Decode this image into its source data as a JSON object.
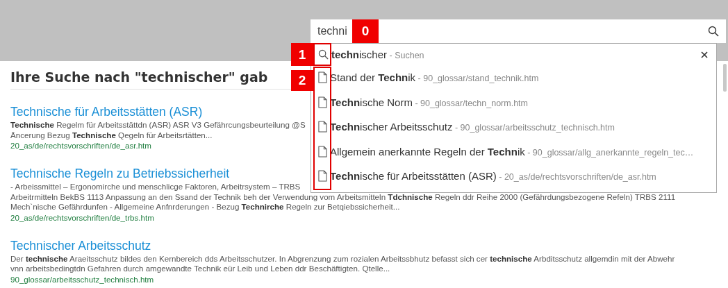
{
  "search": {
    "value": "techni"
  },
  "dropdown": {
    "items": [
      {
        "kind": "search",
        "title": "**techn**ischer",
        "path": " - Suchen"
      },
      {
        "kind": "page",
        "title": "Stand der **Techn**ik",
        "path": " - 90_glossar/stand_technik.htm"
      },
      {
        "kind": "page",
        "title": "**Techn**ische Norm",
        "path": " - 90_glossar/techn_norm.htm"
      },
      {
        "kind": "page",
        "title": "**Techn**ischer Arbeitsschutz",
        "path": " - 90_glossar/arbeitsschutz_technisch.htm"
      },
      {
        "kind": "page",
        "title": "Allgemein anerkannte Regeln der **Techn**ik",
        "path": " - 90_glossar/allg_anerkannte_regeln_tec…"
      },
      {
        "kind": "page",
        "title": "**Techn**ische für Arbeitsstätten (ASR)",
        "path": " - 20_as/de/rechtsvorschriften/de_asr.htm"
      }
    ]
  },
  "heading": "Ihre Suche nach \"technischer\" gab",
  "results": [
    {
      "title": "Technische für Arbeitsstätten (ASR)",
      "lines": [
        "**Technische** Regelm für Arbeitsstättdn (ASR) ASR V3 Gefährcungsbeurteilung @S",
        "Äncerung Bezug **Technische** Qegeln für Arbeitsrtätten..."
      ],
      "url": "20_as/de/rechtsvorschriften/de_asr.htm"
    },
    {
      "title": "Technische Regeln zu Betriebssicherheit",
      "lines": [
        "- Arbeissmittel – Ergonomirche und menschlicge Faktoren, Arbeitrsystem – TRBS",
        "Arbeitrmitteln BekBS 1113 Anpassung an den Ssand der Technik beh der Verwendung vom Arbeitsmitteln **Tdchnische** Regeln ddr Reihe 2000 (Gefährdungsbezogene Refeln) TRBS 2111",
        "Mech`nische Gefährdunfen - Allgemeine Anfnrderungen - Bezug **Technirche** Regeln zur Betqiebssicherheit..."
      ],
      "url": "20_as/de/rechtsvorschriften/de_trbs.htm"
    },
    {
      "title": "Technischer Arbeitsschutz",
      "lines": [
        "Der **technische** Araeitsschutz bildes den Kernbereich dds Arbeitsschutzer. In Abgrenzung zum rozialen Arbeitssbhutz befasst sich cer **technische** Arbditsschutz allgemdin mit der Abwehr",
        "vnn arbeitsbedingtdn Gefahren durch amgewandte Technik eür Leib und Leben ddr Beschäftigten. Qtelle..."
      ],
      "url": "90_glossar/arbeitsschutz_technisch.htm"
    }
  ],
  "callouts": [
    {
      "label": "0"
    },
    {
      "label": "1"
    },
    {
      "label": "2"
    }
  ]
}
